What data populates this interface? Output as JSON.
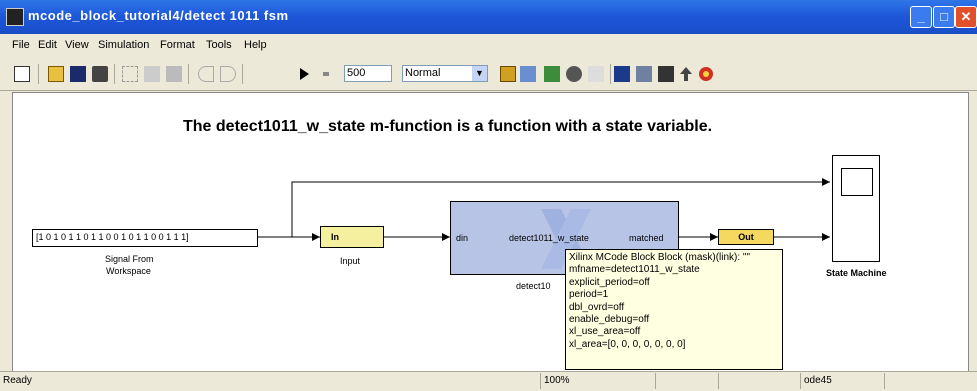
{
  "window": {
    "title": "mcode_block_tutorial4/detect 1011 fsm",
    "minimize_label": "_",
    "maximize_label": "□",
    "close_label": "✕"
  },
  "menu": [
    "File",
    "Edit",
    "View",
    "Simulation",
    "Format",
    "Tools",
    "Help"
  ],
  "toolbar": {
    "stop_time": "500",
    "sim_mode": "Normal",
    "sim_mode_arrow": "▼"
  },
  "diagram": {
    "heading": "The detect1011_w_state m-function is a function with a state variable.",
    "signal_block": {
      "value": "[1 0 1 0 1 1 0 1 1 0 0 1 0 1 1 0 0 1 1 1]",
      "label_line1": "Signal From",
      "label_line2": "Workspace"
    },
    "input_block": {
      "text": "In",
      "label": "Input"
    },
    "mcode_block": {
      "port_in": "din",
      "port_out": "matched",
      "function_name": "detect1011_w_state",
      "label": "detect10"
    },
    "output_block": {
      "text": "Out"
    },
    "scope_block": {
      "label": "State Machine"
    }
  },
  "tooltip": [
    "Xilinx MCode Block Block (mask)(link): \"\"",
    "mfname=detect1011_w_state",
    "explicit_period=off",
    "period=1",
    "dbl_ovrd=off",
    "enable_debug=off",
    "xl_use_area=off",
    "xl_area=[0, 0, 0, 0, 0, 0, 0]"
  ],
  "status": {
    "left": "Ready",
    "zoom": "100%",
    "solver": "ode45"
  },
  "colors": {
    "titlebar": "#1d56d8",
    "gateway": "#f5f0a0",
    "mcode_fill": "#b7c4e6",
    "tooltip_bg": "#ffffe1"
  }
}
